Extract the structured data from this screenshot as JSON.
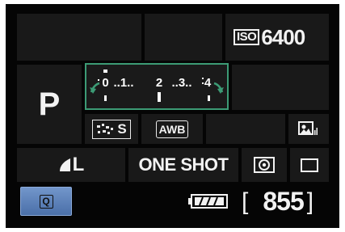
{
  "iso": {
    "badge": "ISO",
    "value": "6400"
  },
  "shooting_mode": {
    "letter": "P"
  },
  "exposure_scale": {
    "labels": [
      "0",
      "..1..",
      "2",
      "..3..",
      "4"
    ],
    "level": 0
  },
  "picture_style": {
    "label": "S"
  },
  "white_balance": {
    "label": "AWB"
  },
  "image_quality": {
    "label": "L"
  },
  "af_mode": {
    "label": "ONE SHOT"
  },
  "quick_control": {
    "label": "Q"
  },
  "shots_remaining": {
    "open": "[",
    "value": "855",
    "close": "]"
  },
  "colors": {
    "accent_green": "#3c9b75",
    "q_button_blue": "#5a7fb8",
    "text": "#f2f2f2"
  }
}
